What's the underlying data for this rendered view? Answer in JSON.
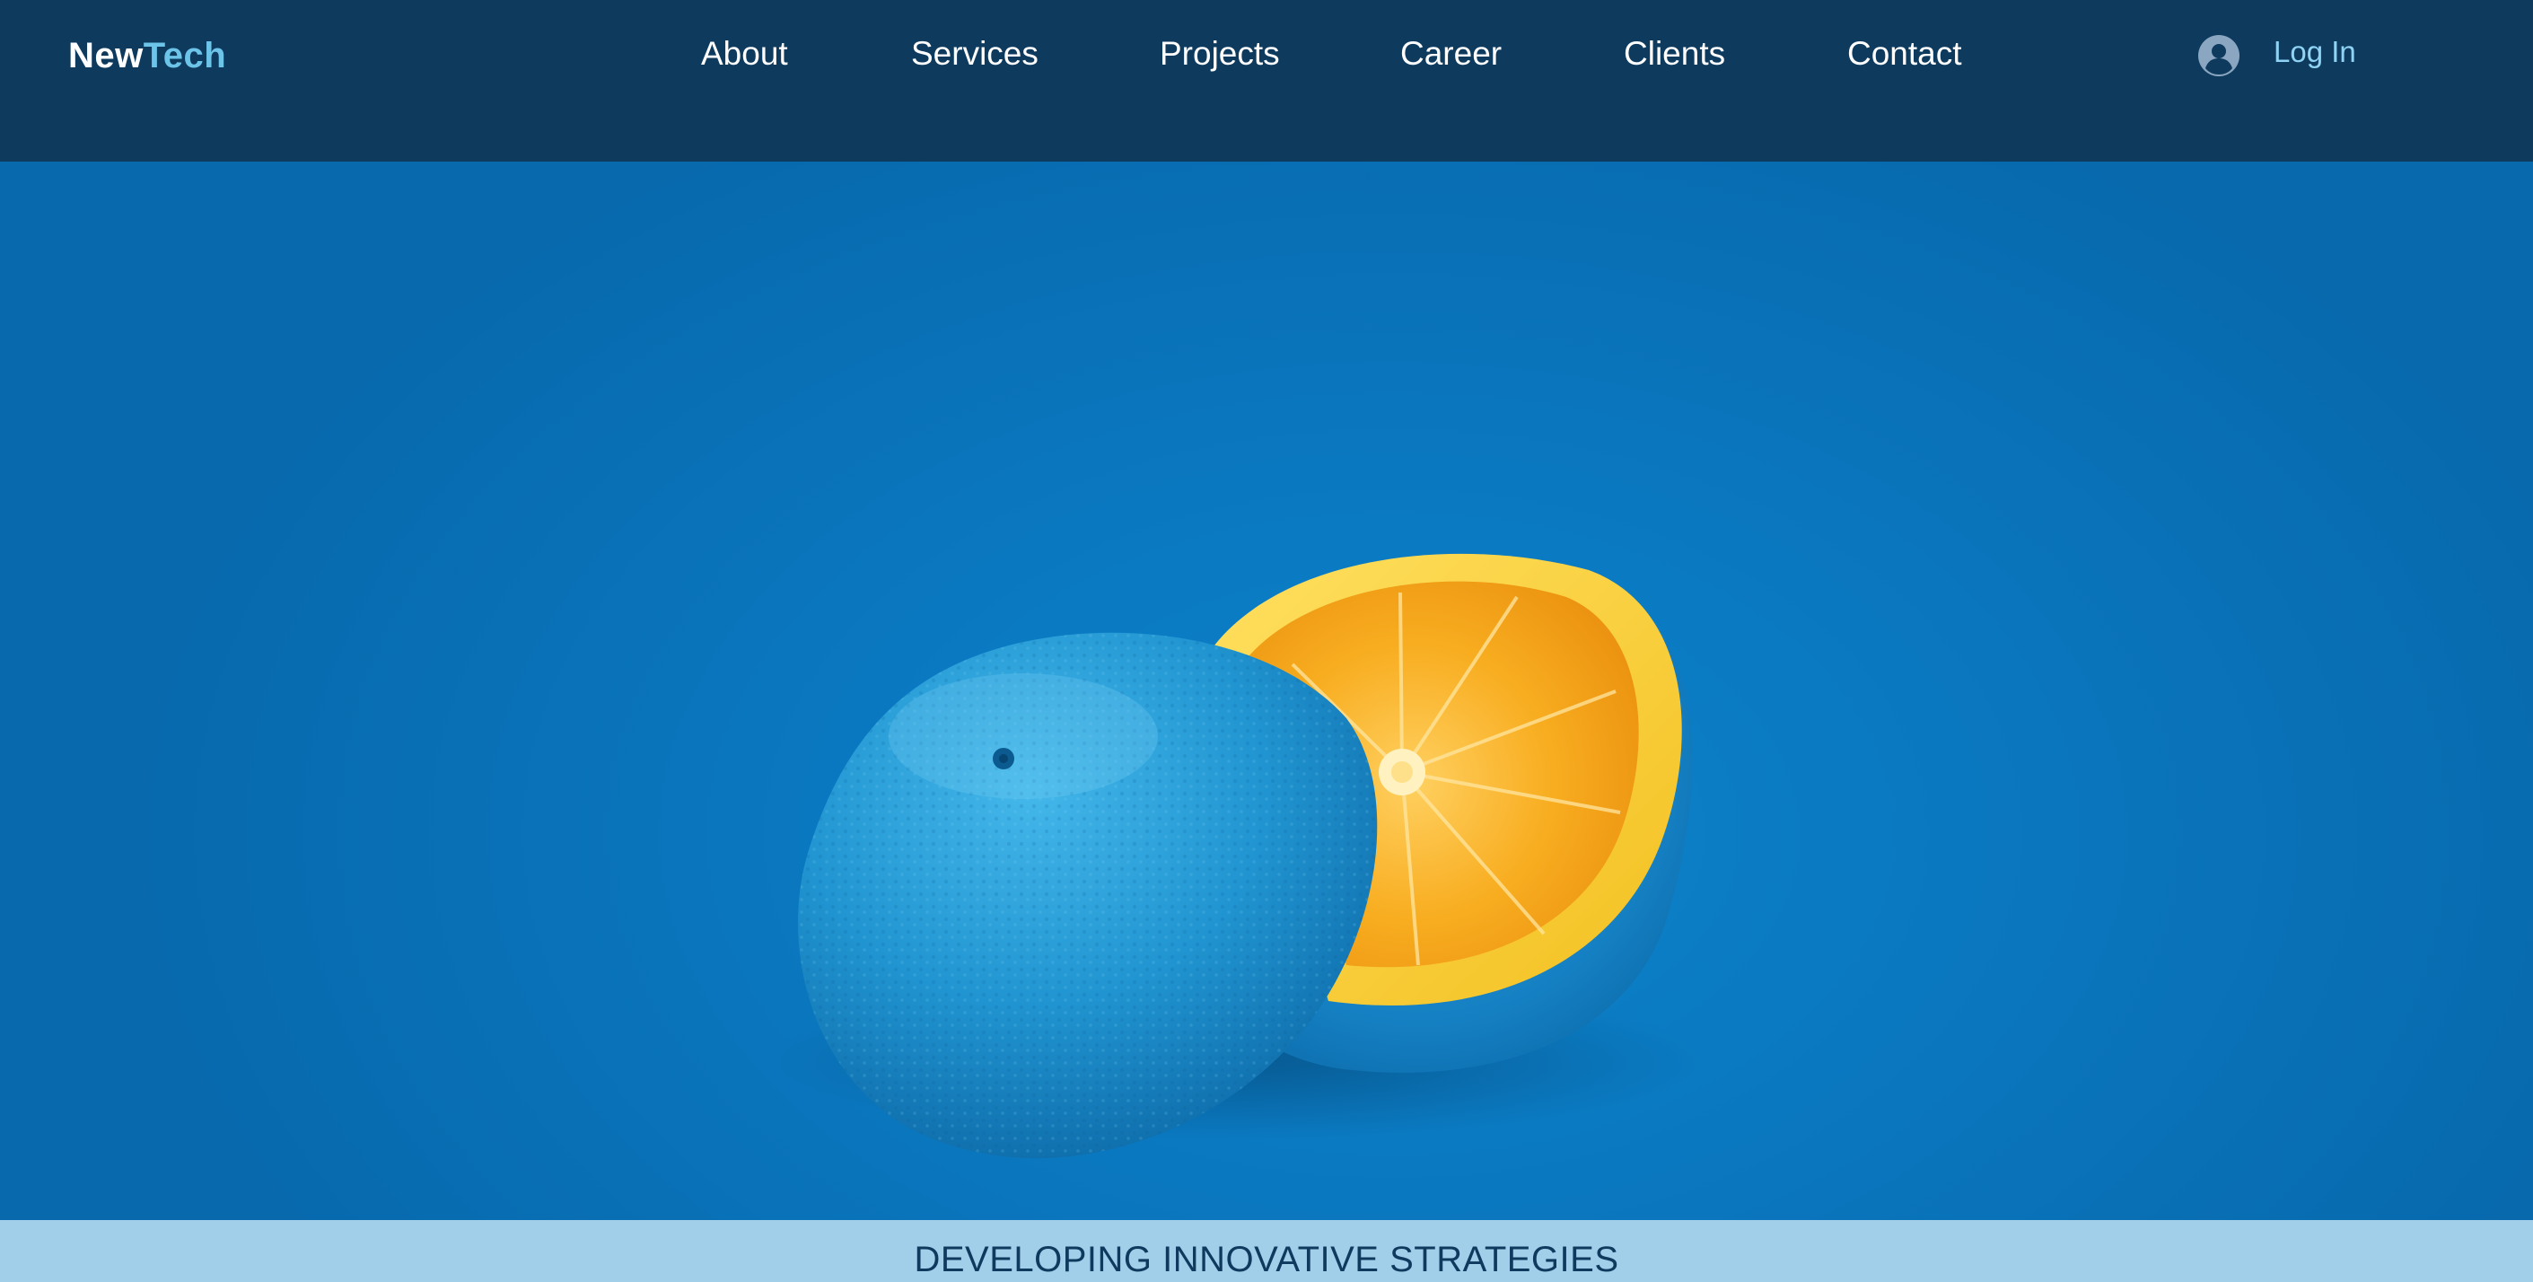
{
  "header": {
    "logo": {
      "part1": "New",
      "part2": "Tech"
    },
    "nav": [
      {
        "label": "About"
      },
      {
        "label": "Services"
      },
      {
        "label": "Projects"
      },
      {
        "label": "Career"
      },
      {
        "label": "Clients"
      },
      {
        "label": "Contact"
      }
    ],
    "login": {
      "label": "Log In",
      "icon": "user-avatar-icon"
    }
  },
  "hero": {
    "image": "painted-orange-halves"
  },
  "banner": {
    "text": "DEVELOPING INNOVATIVE STRATEGIES"
  },
  "colors": {
    "header_bg": "#0e3a5e",
    "hero_bg": "#0a74bd",
    "accent": "#6cc4e8",
    "banner_bg": "#aad4ec",
    "banner_text": "#10395e"
  }
}
